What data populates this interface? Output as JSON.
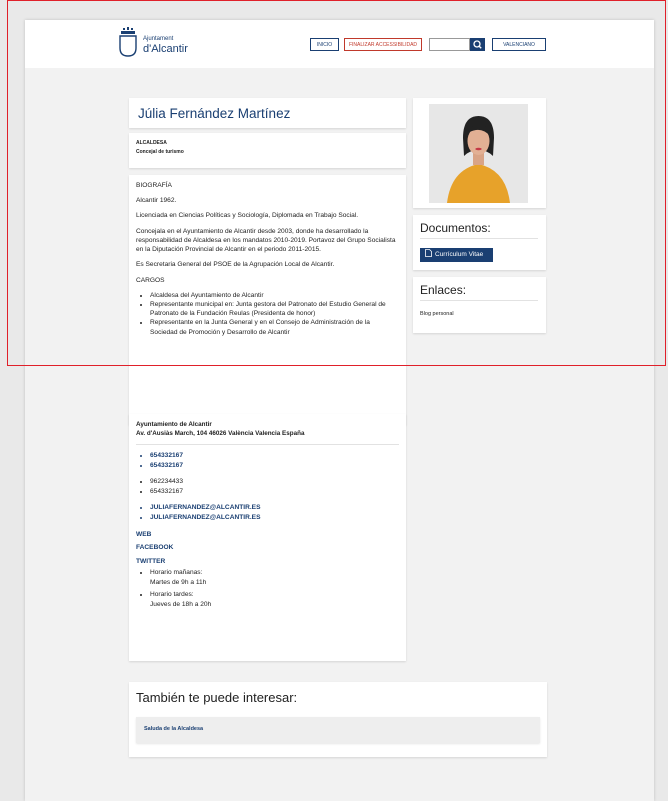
{
  "header": {
    "logo_small": "Ajuntament",
    "logo_big": "d'Alcantir",
    "nav_inicio": "INICIO",
    "nav_accessibility": "FINALIZAR ACCESSIBILIDAD",
    "search_placeholder": "",
    "nav_language": "VALENCIANO"
  },
  "profile": {
    "name": "Júlia Fernández Martínez",
    "role_primary": "ALCALDESA",
    "role_secondary": "Concejal de turismo"
  },
  "biography": {
    "heading": "BIOGRAFÍA",
    "paragraphs": [
      "Alcantir 1962.",
      "Licenciada en Ciencias Políticas y Sociología, Diplomada en Trabajo Social.",
      "Concejala en el Ayuntamiento de Alcantir desde 2003, donde ha desarrollado la responsabilidad de Alcaldesa en los mandatos 2010-2019. Portavoz del Grupo Socialista en la Diputación Provincial de Alcantir en el periodo 2011-2015.",
      "Es Secretaria General del PSOE de la Agrupación Local de Alcantir."
    ],
    "cargos_heading": "CARGOS",
    "cargos": [
      "Alcaldesa del Ayuntamiento de Alcantir",
      "Representante municipal en: Junta gestora del Patronato del Estudio General de Patronato de la Fundación Reulas (Presidenta de honor)",
      "Representante en la Junta General y en el Consejo de Administración de la Sociedad de Promoción y Desarrollo de Alcantir"
    ]
  },
  "contact": {
    "org": "Ayuntamiento de Alcantir",
    "address": "Av. d'Ausiàs March, 104  46026 València Valencia España",
    "mobile_phones": [
      "654332167",
      "654332167"
    ],
    "phones": [
      "962234433",
      "654332167"
    ],
    "emails": [
      "JULIAFERNANDEZ@ALCANTIR.ES",
      "JULIAFERNANDEZ@ALCANTIR.ES"
    ],
    "web": "WEB",
    "facebook": "FACEBOOK",
    "twitter": "TWITTER",
    "hours": [
      {
        "label": "Horario mañanas:",
        "value": "Martes de 9h a 11h"
      },
      {
        "label": "Horario tardes:",
        "value": "Jueves de 18h a 20h"
      }
    ]
  },
  "documents": {
    "title": "Documentos:",
    "cv_button": "Currículum Vitae"
  },
  "links": {
    "title": "Enlaces:",
    "blog": "Blog personal"
  },
  "related": {
    "title": "También te puede interesar:",
    "item": "Saluda de la Alcaldesa"
  },
  "colors": {
    "brand": "#1a3f72",
    "accent_red": "#c0392b",
    "overlay": "#e0202a"
  }
}
